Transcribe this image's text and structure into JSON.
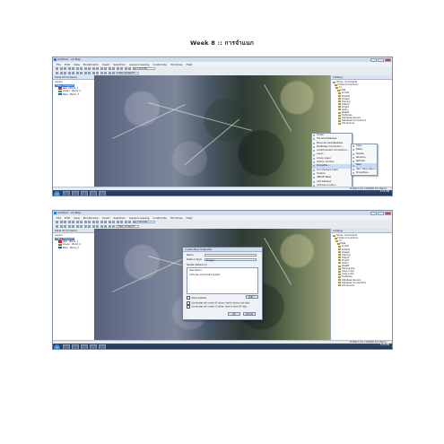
{
  "page_title": "Week 8 :: การจำแนก",
  "screenshot1": {
    "window_title": "Untitled - ArcMap",
    "menu": [
      "File",
      "Edit",
      "View",
      "Bookmarks",
      "Insert",
      "Selection",
      "Geoprocessing",
      "Customize",
      "Windows",
      "Help"
    ],
    "toolbar_scale": "1:60,000",
    "toolbar_layer_combo": "Class_Image.tif",
    "toc_title": "Table Of Contents",
    "toc_items": [
      {
        "label": "Layers",
        "color": ""
      },
      {
        "label": "Class_image.tif",
        "color": ""
      },
      {
        "label": "Red : Band_1",
        "color": "#d62a2a"
      },
      {
        "label": "Green : Band_2",
        "color": "#2fa33a"
      },
      {
        "label": "Blue : Band_3",
        "color": "#2d52c8"
      }
    ],
    "catalog_title": "Catalog",
    "catalog_location": "Location:",
    "catalog_items": [
      "Home - Documents",
      "Folder Connections",
      "C:\\",
      "Data",
      "ArcGIS",
      "Classify",
      "Images",
      "Training",
      "Output",
      "Project",
      "Vector",
      "Week8",
      "Toolboxes",
      "Database Servers",
      "Database Connections",
      "GIS Servers"
    ],
    "context_menu_items": [
      "Copy",
      "Paste",
      "Delete",
      "Rename",
      "Refresh",
      "New",
      "Item Description...",
      "Properties..."
    ],
    "sub_menu_items": [
      "Folder",
      "File Geodatabase",
      "Personal Geodatabase",
      "Database Connection...",
      "ArcGIS Server Connection...",
      "Layer...",
      "Group Layer",
      "Python Toolbox",
      "Shapefile...",
      "Turn Feature Class",
      "Toolbox",
      "dBASE Table",
      "LAS Dataset",
      "Address Locator...",
      "Composite Address Locator...",
      "XML Document"
    ],
    "highlighted_item": "Shapefile...",
    "status_text": "1516813.151 1766888.322 Meters",
    "clock": "3:24 PM"
  },
  "screenshot2": {
    "window_title": "Untitled - ArcMap",
    "menu": [
      "File",
      "Edit",
      "View",
      "Bookmarks",
      "Insert",
      "Selection",
      "Geoprocessing",
      "Customize",
      "Windows",
      "Help"
    ],
    "toolbar_scale": "1:60,000",
    "toolbar_layer_combo": "Class_Image.tif",
    "toc_title": "Table Of Contents",
    "toc_items": [
      {
        "label": "Layers",
        "color": ""
      },
      {
        "label": "Class_image.tif",
        "color": ""
      },
      {
        "label": "Red : Band_1",
        "color": "#d62a2a"
      },
      {
        "label": "Green : Band_2",
        "color": "#2fa33a"
      },
      {
        "label": "Blue : Band_3",
        "color": "#2d52c8"
      }
    ],
    "catalog_title": "Catalog",
    "catalog_items": [
      "Home - Documents",
      "Folder Connections",
      "C:\\",
      "Data",
      "ArcGIS",
      "Classify",
      "Images",
      "Training",
      "Output",
      "Project",
      "Vector",
      "Week8",
      "training.shp",
      "class_1.shp",
      "class_2.shp",
      "Toolboxes",
      "Database Servers",
      "Database Connections",
      "GIS Servers"
    ],
    "dialog": {
      "title": "Create New Shapefile",
      "name_label": "Name:",
      "name_value": "",
      "type_label": "Feature Type:",
      "type_value": "Polygon",
      "sr_label": "Spatial Reference",
      "sr_desc": "Description:",
      "sr_value": "Unknown Coordinate System",
      "show_details": "Show Details",
      "edit_button": "Edit...",
      "chk_m": "Coordinates will contain M values. Used to store route data.",
      "chk_z": "Coordinates will contain Z values. Used to store 3D data.",
      "ok": "OK",
      "cancel": "Cancel"
    },
    "status_text": "1516813.151 1766888.322 Meters",
    "clock": "3:26 PM"
  }
}
